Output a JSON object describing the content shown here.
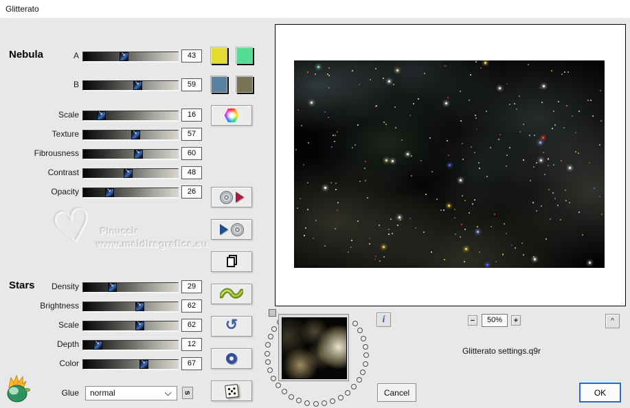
{
  "window": {
    "title": "Glitterato"
  },
  "nebula": {
    "header": "Nebula",
    "sliders": [
      {
        "label": "A",
        "value": 43,
        "swatches": [
          {
            "name": "nebula-color-a1",
            "color": "#e3dc30"
          },
          {
            "name": "nebula-color-a2",
            "color": "#52dd94"
          }
        ]
      },
      {
        "label": "B",
        "value": 59,
        "swatches": [
          {
            "name": "nebula-color-b1",
            "color": "#5a82a0"
          },
          {
            "name": "nebula-color-b2",
            "color": "#787355"
          }
        ]
      },
      {
        "label": "Scale",
        "value": 16
      },
      {
        "label": "Texture",
        "value": 57
      },
      {
        "label": "Fibrousness",
        "value": 60
      },
      {
        "label": "Contrast",
        "value": 48
      },
      {
        "label": "Opacity",
        "value": 26
      }
    ]
  },
  "stars": {
    "header": "Stars",
    "sliders": [
      {
        "label": "Density",
        "value": 29
      },
      {
        "label": "Brightness",
        "value": 62
      },
      {
        "label": "Scale",
        "value": 62
      },
      {
        "label": "Depth",
        "value": 12
      },
      {
        "label": "Color",
        "value": 67
      }
    ]
  },
  "glue": {
    "label": "Glue",
    "selected": "normal",
    "cycle_glyph": "s"
  },
  "watermark": {
    "line1": "Pinuccia",
    "line2": "www.maidiregrafica.eu",
    "heart_glyph": "♡"
  },
  "side_toolbar": {
    "buttons": [
      {
        "name": "color-picker-button",
        "icon": "rainbow-hexagon-icon"
      },
      {
        "name": "save-settings-button",
        "icon": "disc-export-icon"
      },
      {
        "name": "load-settings-button",
        "icon": "disc-import-icon"
      },
      {
        "name": "copy-settings-button",
        "icon": "pages-icon"
      },
      {
        "name": "ribbon-button",
        "icon": "green-wave-icon"
      },
      {
        "name": "undo-button",
        "icon": "undo-arrow-icon"
      },
      {
        "name": "reset-button",
        "icon": "blue-ring-icon"
      },
      {
        "name": "randomize-button",
        "icon": "dice-icon"
      }
    ]
  },
  "preview": {
    "zoom_out_glyph": "−",
    "zoom_level": "50%",
    "zoom_in_glyph": "+",
    "collapse_glyph": "^",
    "info_glyph": "i",
    "settings_filename": "Glitterato settings.q9r"
  },
  "actions": {
    "cancel_label": "Cancel",
    "ok_label": "OK"
  },
  "palette": {
    "background": "#e9e8e8",
    "titlebar": "#ffffff",
    "ok_border": "#1f6fd0",
    "star_colors": [
      "#ffffff",
      "#f4f0e0",
      "#ffd84d",
      "#f0e0a0",
      "#ff8040",
      "#ff4030",
      "#5b6cff",
      "#9db5ff",
      "#7ef0b0"
    ]
  }
}
